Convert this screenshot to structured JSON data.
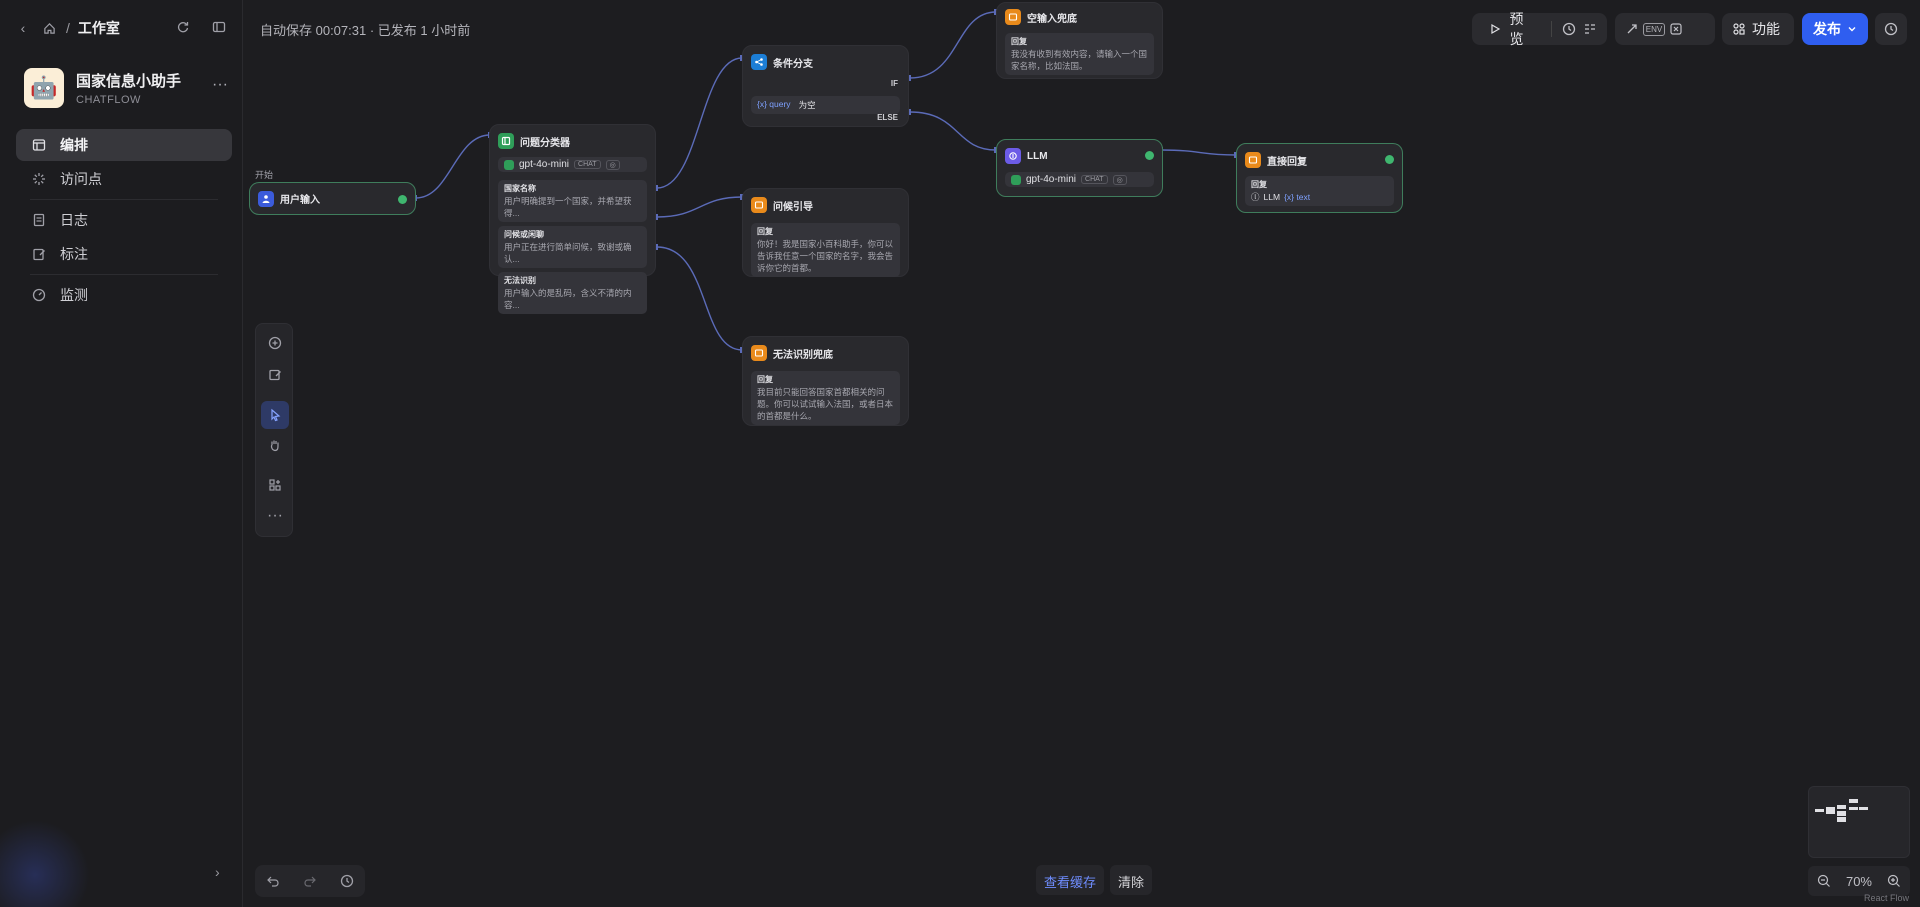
{
  "sidebar": {
    "breadcrumb": "工作室",
    "app": {
      "name": "国家信息小助手",
      "type": "CHATFLOW",
      "avatar": "🤖"
    },
    "nav": [
      {
        "label": "编排",
        "icon": "layout-icon",
        "active": true
      },
      {
        "label": "访问点",
        "icon": "burst-icon"
      },
      {
        "label": "日志",
        "icon": "log-icon"
      },
      {
        "label": "标注",
        "icon": "annotate-icon"
      },
      {
        "label": "监测",
        "icon": "gauge-icon"
      }
    ]
  },
  "topbar": {
    "autosave": "自动保存 00:07:31 · 已发布 1 小时前",
    "preview": "预览",
    "env": "ENV",
    "features": "功能",
    "publish": "发布"
  },
  "nodes": {
    "start": {
      "label": "开始",
      "title": "用户输入"
    },
    "classifier": {
      "title": "问题分类器",
      "model": "gpt-4o-mini",
      "model_tag": "CHAT",
      "classes": [
        {
          "name": "国家名称",
          "desc": "用户明确提到一个国家，并希望获得..."
        },
        {
          "name": "问候或闲聊",
          "desc": "用户正在进行简单问候，致谢或确认..."
        },
        {
          "name": "无法识别",
          "desc": "用户输入的是乱码，含义不清的内容..."
        }
      ]
    },
    "branch": {
      "title": "条件分支",
      "if_label": "IF",
      "else_label": "ELSE",
      "var": "{x} query",
      "op": "为空"
    },
    "empty_reply": {
      "title": "空输入兜底",
      "box_title": "回复",
      "text": "我没有收到有效内容，请输入一个国家名称，比如法国。"
    },
    "greet_reply": {
      "title": "问候引导",
      "box_title": "回复",
      "text": "你好！我是国家小百科助手，你可以告诉我任意一个国家的名字，我会告诉你它的首都。"
    },
    "unknown_reply": {
      "title": "无法识别兜底",
      "box_title": "回复",
      "text": "我目前只能回答国家首都相关的问题。你可以试试输入法国，或者日本的首都是什么。"
    },
    "llm": {
      "title": "LLM",
      "model": "gpt-4o-mini",
      "model_tag": "CHAT"
    },
    "direct_reply": {
      "title": "直接回复",
      "box_title": "回复",
      "ref_node": "LLM",
      "ref_var": "{x} text"
    }
  },
  "canvas": {
    "view_cache": "查看缓存",
    "clear": "清除",
    "zoom": "70%",
    "attribution": "React Flow"
  }
}
